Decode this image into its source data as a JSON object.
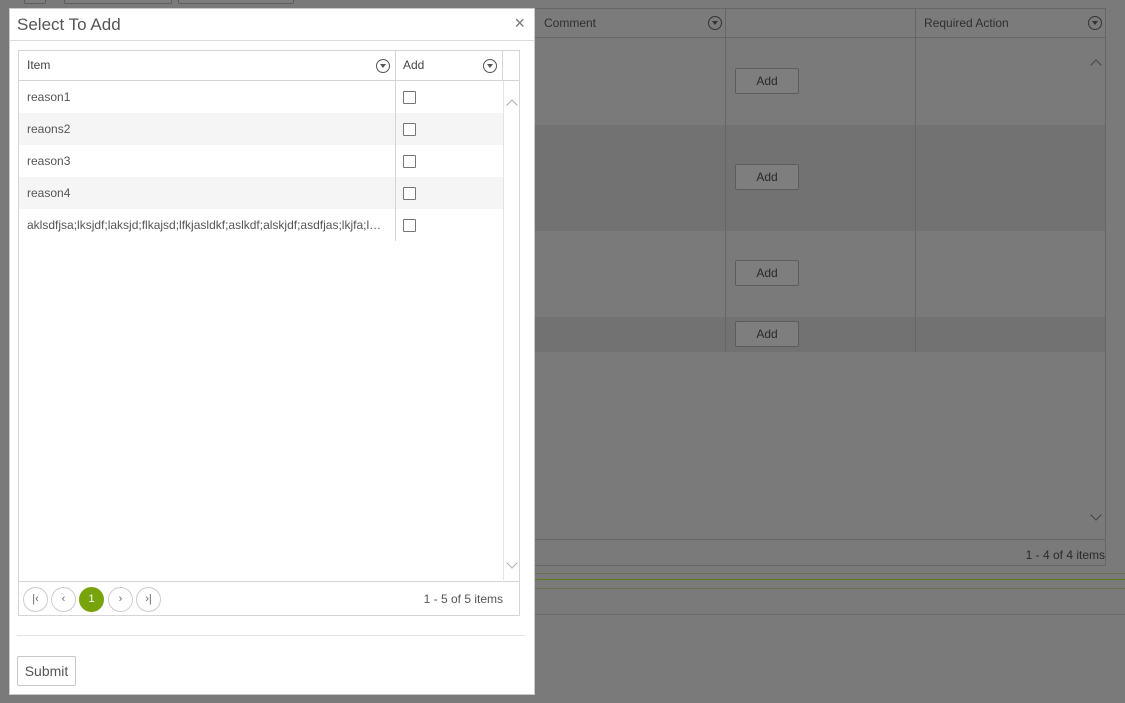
{
  "background": {
    "columns": [
      {
        "label": "Comment"
      },
      {
        "label": ""
      },
      {
        "label": "Required Action"
      }
    ],
    "rows": [
      {
        "add_label": "Add"
      },
      {
        "add_label": "Add"
      },
      {
        "add_label": "Add"
      },
      {
        "add_label": "Add"
      }
    ],
    "pager_info": "1 - 4 of 4 items"
  },
  "modal": {
    "title": "Select To Add",
    "close_glyph": "×",
    "columns": {
      "item": "Item",
      "add": "Add"
    },
    "rows": [
      {
        "item": "reason1",
        "checked": false
      },
      {
        "item": "reaons2",
        "checked": false
      },
      {
        "item": "reason3",
        "checked": false
      },
      {
        "item": "reason4",
        "checked": false
      },
      {
        "item": "aklsdfjsa;lksjdf;laksjd;flkajsd;lfkjasldkf;aslkdf;alskjdf;asdfjas;lkjfa;lsdkjf;alskdjf",
        "checked": false
      }
    ],
    "pager": {
      "first_glyph": "|‹",
      "prev_glyph": "‹",
      "current_page": "1",
      "next_glyph": "›",
      "last_glyph": "›|",
      "info": "1 - 5 of 5 items"
    },
    "submit_label": "Submit"
  },
  "colors": {
    "accent": "#78a30c",
    "overlay": "#7a7a7a"
  },
  "icons": [
    "filter-icon",
    "close-icon",
    "chevron-up-icon",
    "chevron-down-icon",
    "first-page-icon",
    "prev-page-icon",
    "next-page-icon",
    "last-page-icon"
  ]
}
